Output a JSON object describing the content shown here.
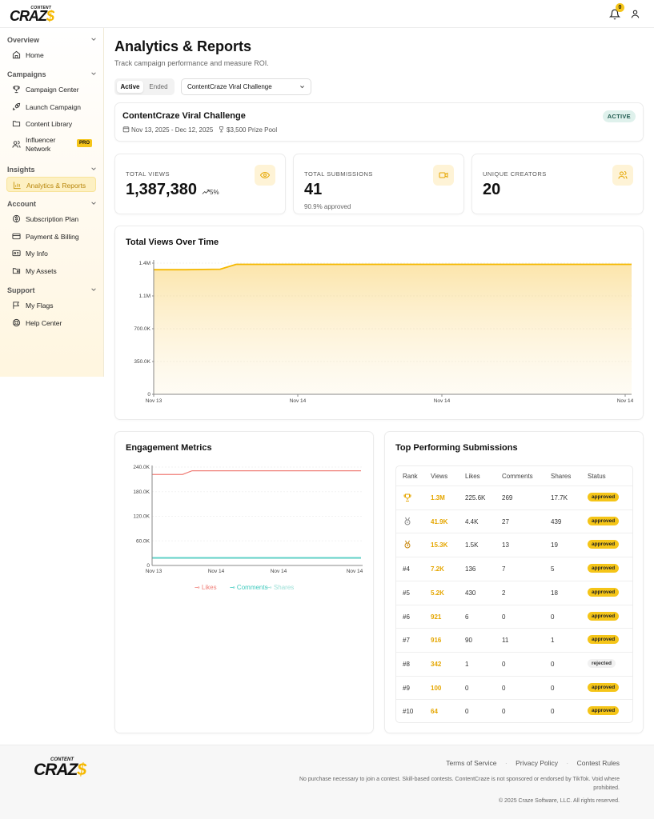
{
  "brand": {
    "logo_small": "CONTENT",
    "logo_big_prefix": "CRAZ",
    "logo_big_suffix": "$",
    "notif_count": "0"
  },
  "sidebar": {
    "sections": [
      {
        "title": "Overview",
        "items": [
          {
            "label": "Home",
            "icon": "home-icon"
          }
        ]
      },
      {
        "title": "Campaigns",
        "items": [
          {
            "label": "Campaign Center",
            "icon": "trophy-icon"
          },
          {
            "label": "Launch Campaign",
            "icon": "rocket-icon"
          },
          {
            "label": "Content Library",
            "icon": "folder-icon"
          },
          {
            "label": "Influencer Network",
            "icon": "users-icon",
            "badge": "PRO"
          }
        ]
      },
      {
        "title": "Insights",
        "items": [
          {
            "label": "Analytics & Reports",
            "icon": "bar-chart-icon",
            "active": true
          }
        ]
      },
      {
        "title": "Account",
        "items": [
          {
            "label": "Subscription Plan",
            "icon": "dollar-circle-icon"
          },
          {
            "label": "Payment & Billing",
            "icon": "credit-card-icon"
          },
          {
            "label": "My Info",
            "icon": "id-card-icon"
          },
          {
            "label": "My Assets",
            "icon": "folder-icon"
          }
        ]
      },
      {
        "title": "Support",
        "items": [
          {
            "label": "My Flags",
            "icon": "flag-icon"
          },
          {
            "label": "Help Center",
            "icon": "lifebuoy-icon"
          }
        ]
      }
    ]
  },
  "page": {
    "title": "Analytics & Reports",
    "subtitle": "Track campaign performance and measure ROI.",
    "tabs": {
      "active": "Active",
      "ended": "Ended"
    },
    "campaign_select": "ContentCraze Viral Challenge"
  },
  "campaign": {
    "title": "ContentCraze Viral Challenge",
    "dates": "Nov 13, 2025 - Dec 12, 2025",
    "prize": "$3,500 Prize Pool",
    "status": "ACTIVE"
  },
  "stats": [
    {
      "label": "TOTAL VIEWS",
      "value": "1,387,380",
      "delta": "5%",
      "icon": "eye-icon"
    },
    {
      "label": "TOTAL SUBMISSIONS",
      "value": "41",
      "note": "90.9% approved",
      "icon": "video-icon"
    },
    {
      "label": "UNIQUE CREATORS",
      "value": "20",
      "icon": "users-icon"
    }
  ],
  "views_chart": {
    "title": "Total Views Over Time",
    "chart_data": {
      "type": "area",
      "x": [
        "Nov 13",
        "Nov 13",
        "Nov 13",
        "Nov 14",
        "Nov 14",
        "Nov 14",
        "Nov 14"
      ],
      "x_ticks": [
        "Nov 13",
        "Nov 14",
        "Nov 14",
        "Nov 14"
      ],
      "y_ticks": [
        "0",
        "350.0K",
        "700.0K",
        "1.1M",
        "1.4M"
      ],
      "series": [
        {
          "values": [
            1330000,
            1330000,
            1335000,
            1387380,
            1387380,
            1387380,
            1387380
          ]
        }
      ],
      "ylim": [
        0,
        1400000
      ],
      "color": "#f5b800"
    }
  },
  "engagement_chart": {
    "title": "Engagement Metrics",
    "chart_data": {
      "type": "line",
      "x_ticks": [
        "Nov 13",
        "Nov 14",
        "Nov 14",
        "Nov 14"
      ],
      "y_ticks": [
        "0",
        "60.0K",
        "120.0K",
        "180.0K",
        "240.0K"
      ],
      "ylim": [
        0,
        240000
      ],
      "series": [
        {
          "name": "Likes",
          "color": "#f07f78",
          "values": [
            222000,
            222000,
            222000,
            231000,
            231000,
            231000,
            231000,
            231000
          ]
        },
        {
          "name": "Comments",
          "color": "#3cc9bd",
          "values": [
            19000,
            19000,
            19000,
            19000,
            19000,
            19000,
            19000,
            19000
          ]
        },
        {
          "name": "Shares",
          "color": "#9ee0d8",
          "values": [
            17000,
            17000,
            17000,
            17000,
            17000,
            17000,
            17000,
            17000
          ]
        }
      ]
    }
  },
  "top_submissions": {
    "title": "Top Performing Submissions",
    "headers": [
      "Rank",
      "Views",
      "Likes",
      "Comments",
      "Shares",
      "Status"
    ],
    "rows": [
      {
        "rank": "",
        "rank_icon": "trophy-icon",
        "views": "1.3M",
        "likes": "225.6K",
        "comments": "269",
        "shares": "17.7K",
        "status": "approved"
      },
      {
        "rank": "",
        "rank_icon": "silver-medal-icon",
        "views": "41.9K",
        "likes": "4.4K",
        "comments": "27",
        "shares": "439",
        "status": "approved"
      },
      {
        "rank": "",
        "rank_icon": "bronze-medal-icon",
        "views": "15.3K",
        "likes": "1.5K",
        "comments": "13",
        "shares": "19",
        "status": "approved"
      },
      {
        "rank": "#4",
        "views": "7.2K",
        "likes": "136",
        "comments": "7",
        "shares": "5",
        "status": "approved"
      },
      {
        "rank": "#5",
        "views": "5.2K",
        "likes": "430",
        "comments": "2",
        "shares": "18",
        "status": "approved"
      },
      {
        "rank": "#6",
        "views": "921",
        "likes": "6",
        "comments": "0",
        "shares": "0",
        "status": "approved"
      },
      {
        "rank": "#7",
        "views": "916",
        "likes": "90",
        "comments": "11",
        "shares": "1",
        "status": "approved"
      },
      {
        "rank": "#8",
        "views": "342",
        "likes": "1",
        "comments": "0",
        "shares": "0",
        "status": "rejected"
      },
      {
        "rank": "#9",
        "views": "100",
        "likes": "0",
        "comments": "0",
        "shares": "0",
        "status": "approved"
      },
      {
        "rank": "#10",
        "views": "64",
        "likes": "0",
        "comments": "0",
        "shares": "0",
        "status": "approved"
      }
    ]
  },
  "footer": {
    "links": [
      "Terms of Service",
      "Privacy Policy",
      "Contest Rules"
    ],
    "disclaimer": "No purchase necessary to join a contest. Skill-based contests. ContentCraze is not sponsored or endorsed by TikTok. Void where prohibited.",
    "copyright": "© 2025 Craze Software, LLC. All rights reserved."
  }
}
